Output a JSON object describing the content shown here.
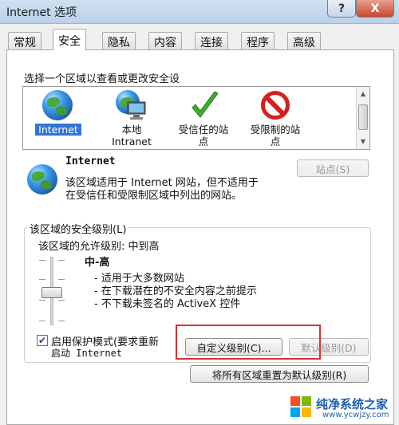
{
  "window": {
    "title": "Internet 选项",
    "help_label": "?",
    "close_label": "X"
  },
  "tabs": [
    {
      "label": "常规"
    },
    {
      "label": "安全"
    },
    {
      "label": "隐私"
    },
    {
      "label": "内容"
    },
    {
      "label": "连接"
    },
    {
      "label": "程序"
    },
    {
      "label": "高级"
    }
  ],
  "security": {
    "zone_prompt": "选择一个区域以查看或更改安全设",
    "zones": [
      {
        "label": "Internet",
        "icon": "globe-icon",
        "selected": true
      },
      {
        "label_line1": "本地",
        "label_line2": "Intranet",
        "icon": "local-intranet-icon"
      },
      {
        "label_line1": "受信任的站",
        "label_line2": "点",
        "icon": "check-icon"
      },
      {
        "label_line1": "受限制的站",
        "label_line2": "点",
        "icon": "no-entry-icon"
      }
    ],
    "selected_zone": {
      "title": "Internet",
      "desc_line1": "该区域适用于 Internet 网站，但不适用于",
      "desc_line2": "在受信任和受限制区域中列出的网站。",
      "sites_button": "站点(S)"
    },
    "level_group": {
      "title": "该区域的安全级别(L)",
      "allowed_levels": "该区域的允许级别: 中到高",
      "level_name": "中-高",
      "bullets": [
        "- 适用于大多数网站",
        "- 在下载潜在的不安全内容之前提示",
        "- 不下载未签名的 ActiveX 控件"
      ],
      "slider_level": 0.5,
      "protected_mode_line1": "启用保护模式(要求重新",
      "protected_mode_line2": "启动 Internet",
      "protected_mode_checked": true,
      "custom_level_button": "自定义级别(C)...",
      "default_level_button": "默认级别(D)"
    },
    "reset_all_button": "将所有区域重置为默认级别(R)"
  },
  "watermark": {
    "text": "纯净系统之家",
    "url": "www.ycwjzy.com"
  },
  "colors": {
    "selection": "#3375d6",
    "highlight_box": "#d93030"
  }
}
